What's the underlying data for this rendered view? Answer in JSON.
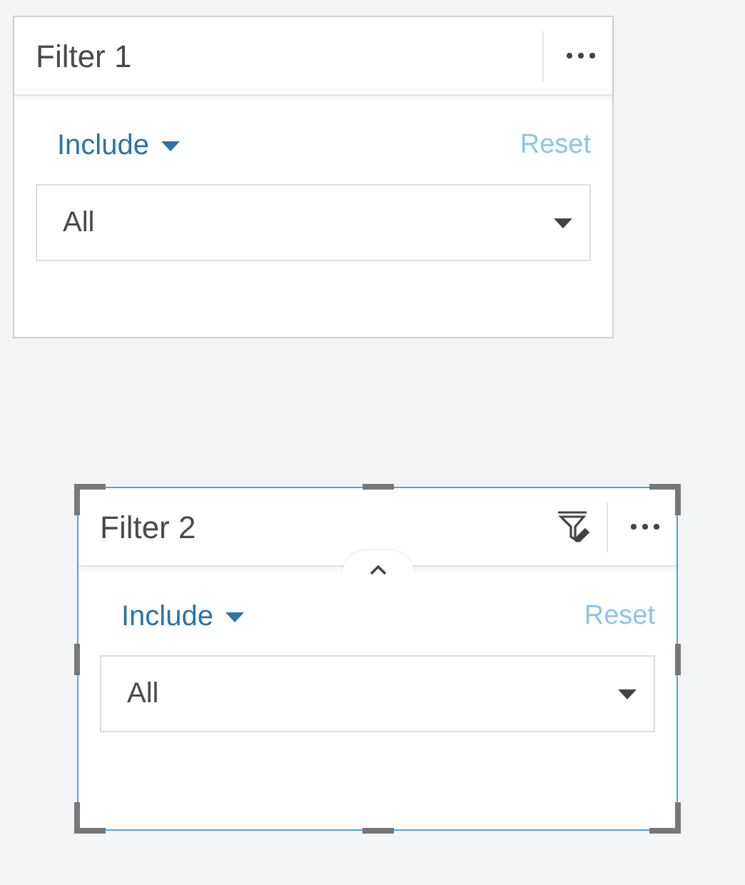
{
  "cards": [
    {
      "title": "Filter 1",
      "mode_label": "Include",
      "reset": "Reset",
      "value": "All",
      "selected": false
    },
    {
      "title": "Filter 2",
      "mode_label": "Include",
      "reset": "Reset",
      "value": "All",
      "selected": true
    }
  ]
}
